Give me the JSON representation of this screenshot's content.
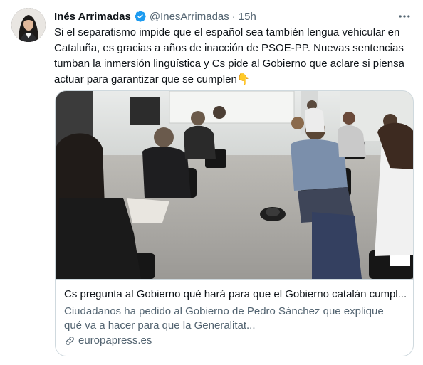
{
  "tweet": {
    "author_name": "Inés Arrimadas",
    "handle": "@InesArrimadas",
    "separator": "·",
    "time": "15h",
    "text": "Si el separatismo impide que el español sea también lengua vehicular en Cataluña, es gracias a años de inacción de PSOE-PP. Nuevas sentencias tumban la inmersión lingüística y Cs pide al Gobierno que aclare si piensa actuar para garantizar que se cumplen👇"
  },
  "card": {
    "title": "Cs pregunta al Gobierno qué hará para que el Gobierno catalán cumpl...",
    "description": "Ciudadanos ha pedido al Gobierno de Pedro Sánchez que explique qué va a hacer para que la Generalitat...",
    "domain": "europapress.es"
  },
  "icons": {
    "verified": "verified-badge-icon",
    "more": "more-dots-icon",
    "link": "link-icon"
  },
  "colors": {
    "verified_blue": "#1d9bf0",
    "secondary_text": "#536471",
    "border": "#cfd9de"
  }
}
